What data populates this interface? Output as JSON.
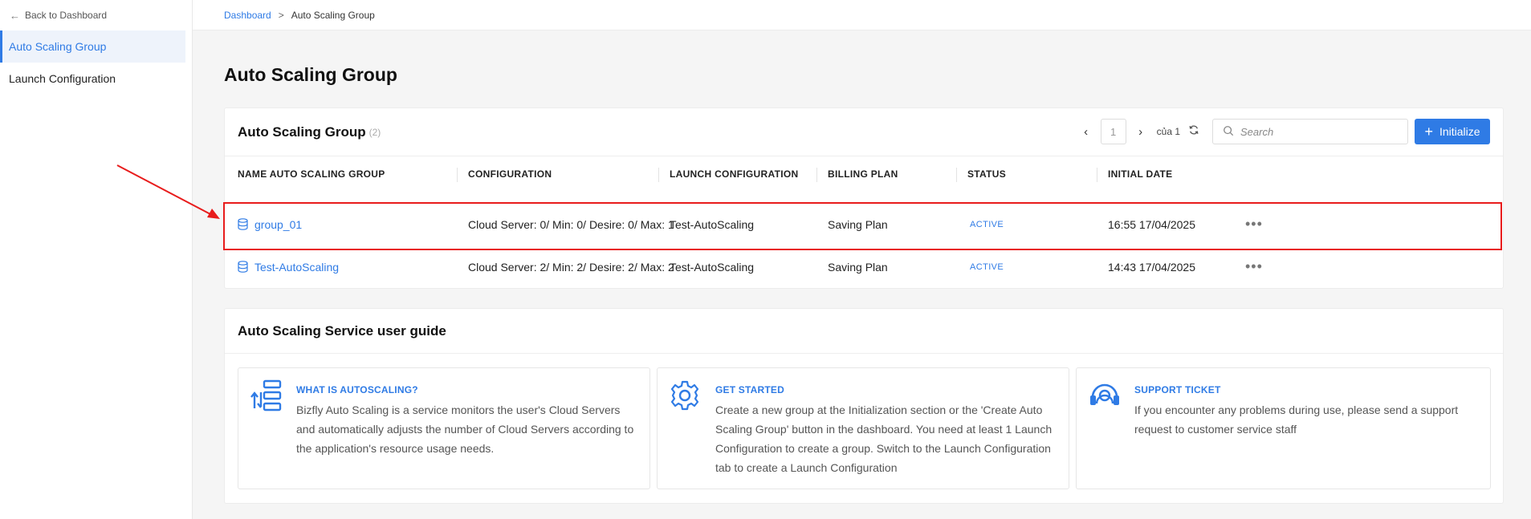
{
  "sidebar": {
    "back_label": "Back to Dashboard",
    "items": [
      {
        "label": "Auto Scaling Group"
      },
      {
        "label": "Launch Configuration"
      }
    ]
  },
  "breadcrumb": {
    "root": "Dashboard",
    "separator": ">",
    "current": "Auto Scaling Group"
  },
  "page": {
    "title": "Auto Scaling Group"
  },
  "groups_card": {
    "title": "Auto Scaling Group",
    "count": "(2)",
    "pagination": {
      "current_page": "1",
      "of_label": "của 1"
    },
    "search_placeholder": "Search",
    "initialize_label": "Initialize",
    "columns": [
      "NAME AUTO SCALING GROUP",
      "CONFIGURATION",
      "LAUNCH CONFIGURATION",
      "BILLING PLAN",
      "STATUS",
      "INITIAL DATE"
    ],
    "rows": [
      {
        "name": "group_01",
        "configuration": "Cloud Server: 0/ Min: 0/ Desire: 0/ Max: 1",
        "launch_configuration": "Test-AutoScaling",
        "billing_plan": "Saving Plan",
        "status": "ACTIVE",
        "initial_date": "16:55 17/04/2025"
      },
      {
        "name": "Test-AutoScaling",
        "configuration": "Cloud Server: 2/ Min: 2/ Desire: 2/ Max: 2",
        "launch_configuration": "Test-AutoScaling",
        "billing_plan": "Saving Plan",
        "status": "ACTIVE",
        "initial_date": "14:43 17/04/2025"
      }
    ]
  },
  "guide_card": {
    "title": "Auto Scaling Service user guide",
    "items": [
      {
        "icon": "autoscaling-icon",
        "title": "WHAT IS AUTOSCALING?",
        "desc": "Bizfly Auto Scaling is a service monitors the user's Cloud Servers and automatically adjusts the number of Cloud Servers according to the application's resource usage needs."
      },
      {
        "icon": "gear-icon",
        "title": "GET STARTED",
        "desc": "Create a new group at the Initialization section or the 'Create Auto Scaling Group' button in the dashboard. You need at least 1 Launch Configuration to create a group. Switch to the Launch Configuration tab to create a Launch Configuration"
      },
      {
        "icon": "headset-icon",
        "title": "SUPPORT TICKET",
        "desc": "If you encounter any problems during use, please send a support request to customer service staff"
      }
    ]
  },
  "colors": {
    "accent": "#2f7be5",
    "annotation": "#e81c1c"
  }
}
